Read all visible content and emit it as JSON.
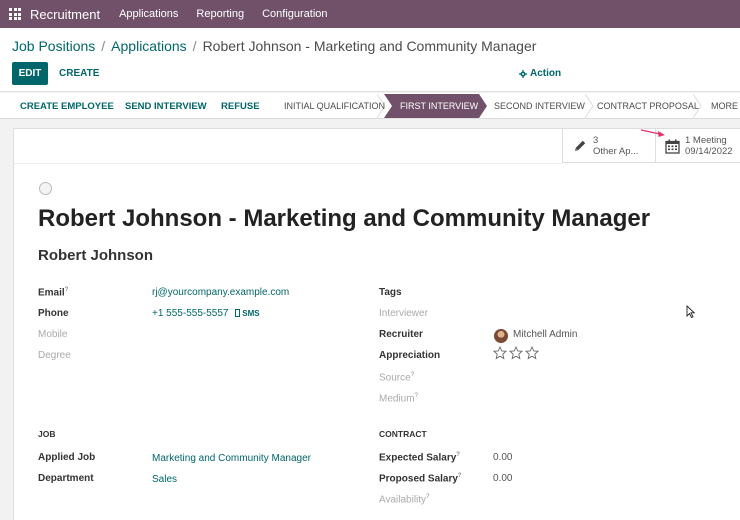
{
  "navbar": {
    "brand": "Recruitment",
    "menu": [
      "Applications",
      "Reporting",
      "Configuration"
    ]
  },
  "breadcrumb": {
    "items": [
      "Job Positions",
      "Applications"
    ],
    "current": "Robert Johnson - Marketing and Community Manager"
  },
  "toolbar": {
    "edit_label": "EDIT",
    "create_label": "CREATE",
    "action_label": "Action"
  },
  "statusbar": {
    "buttons": [
      "CREATE EMPLOYEE",
      "SEND INTERVIEW",
      "REFUSE"
    ],
    "stages": [
      "INITIAL QUALIFICATION",
      "FIRST INTERVIEW",
      "SECOND INTERVIEW",
      "CONTRACT PROPOSAL",
      "MORE"
    ],
    "active_stage": "FIRST INTERVIEW"
  },
  "smart_buttons": {
    "other_applications": {
      "count": "3",
      "label": "Other Ap..."
    },
    "meeting": {
      "count_label": "1 Meeting",
      "date": "09/14/2022"
    }
  },
  "record": {
    "title": "Robert Johnson - Marketing and Community Manager",
    "applicant_name": "Robert Johnson"
  },
  "fields_left": {
    "email_label": "Email",
    "email_value": "rj@yourcompany.example.com",
    "phone_label": "Phone",
    "phone_value": "+1 555-555-5557",
    "sms_label": "SMS",
    "mobile_label": "Mobile",
    "degree_label": "Degree"
  },
  "fields_right": {
    "tags_label": "Tags",
    "interviewer_label": "Interviewer",
    "recruiter_label": "Recruiter",
    "recruiter_value": "Mitchell Admin",
    "appreciation_label": "Appreciation",
    "appreciation_stars": 0,
    "appreciation_max": 3,
    "source_label": "Source",
    "medium_label": "Medium"
  },
  "job_group": {
    "title": "JOB",
    "applied_job_label": "Applied Job",
    "applied_job_value": "Marketing and Community Manager",
    "department_label": "Department",
    "department_value": "Sales"
  },
  "contract_group": {
    "title": "CONTRACT",
    "expected_salary_label": "Expected Salary",
    "expected_salary_value": "0.00",
    "proposed_salary_label": "Proposed Salary",
    "proposed_salary_value": "0.00",
    "availability_label": "Availability"
  },
  "colors": {
    "navbar": "#71506a",
    "primary": "#01666b",
    "active_stage": "#71506a",
    "arrow": "#e8336a"
  }
}
